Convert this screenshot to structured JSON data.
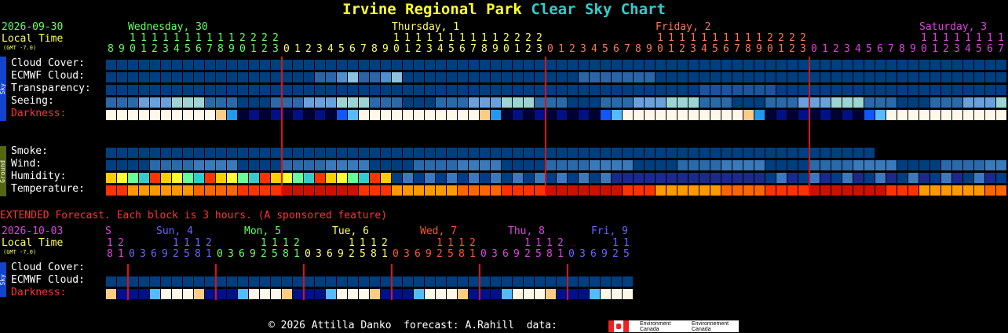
{
  "title": {
    "part1": "Irvine Regional Park",
    "part2": "Clear Sky Chart"
  },
  "colors": {
    "title1": "#ffff33",
    "title2": "#33cccc",
    "date": "#66ff66",
    "localtime": "#ffff66",
    "label_red": "#ff3333",
    "footer": "#ffffff"
  },
  "header": {
    "date": "2026-09-30",
    "local_time": "Local Time",
    "gmt": "(GMT -7.0)",
    "days": [
      {
        "label": "Wednesday, 30",
        "color": "#66ff66"
      },
      {
        "label": "Thursday, 1",
        "color": "#ffff66"
      },
      {
        "label": "Friday, 2",
        "color": "#ff7755"
      },
      {
        "label": "Saturday, 3",
        "color": "#dd44dd"
      }
    ]
  },
  "sky_side_label": "Sky",
  "ground_side_label": "Ground",
  "rows": {
    "cloud_cover": "Cloud Cover:",
    "ecmwf_cloud": "ECMWF Cloud:",
    "transparency": "Transparency:",
    "seeing": "Seeing:",
    "darkness": "Darkness:",
    "smoke": "Smoke:",
    "wind": "Wind:",
    "humidity": "Humidity:",
    "temperature": "Temperature:"
  },
  "extended": {
    "note": "EXTENDED Forecast. Each block is 3 hours. (A sponsored feature)",
    "date": "2026-10-03",
    "local_time": "Local Time",
    "gmt": "(GMT -7.0)",
    "days": [
      {
        "label": "S",
        "color": "#dd44dd"
      },
      {
        "label": "Sun, 4",
        "color": "#6666ff"
      },
      {
        "label": "Mon, 5",
        "color": "#66ff66"
      },
      {
        "label": "Tue, 6",
        "color": "#ffff66"
      },
      {
        "label": "Wed, 7",
        "color": "#ff5533"
      },
      {
        "label": "Thu, 8",
        "color": "#dd44dd"
      },
      {
        "label": "Fri, 9",
        "color": "#6666ff"
      }
    ],
    "rows": {
      "cloud_cover": "Cloud Cover:",
      "ecmwf_cloud": "ECMWF Cloud:",
      "darkness": "Darkness:"
    }
  },
  "footer": {
    "text": "© 2026 Attilla Danko  forecast: A.Rahill  data:",
    "logo1": "Environment Canada",
    "logo2": "Environnement Canada"
  }
}
